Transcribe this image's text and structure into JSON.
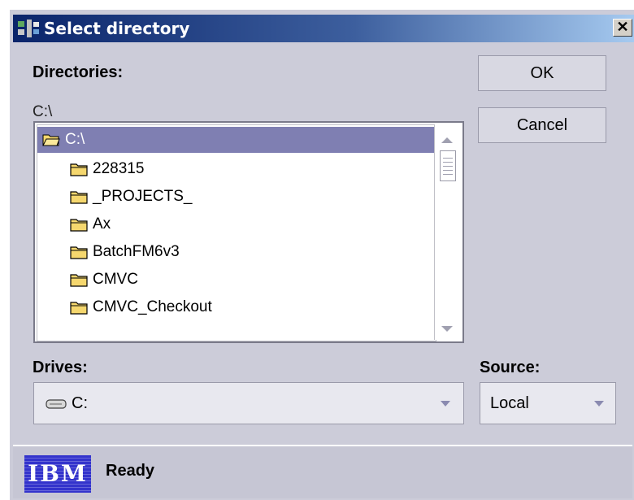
{
  "window": {
    "title": "Select directory",
    "close_symbol": "✕"
  },
  "directories": {
    "label": "Directories:",
    "current_path": "C:\\",
    "items": [
      {
        "label": "C:\\",
        "icon": "open-folder-icon",
        "selected": true
      },
      {
        "label": "228315",
        "icon": "folder-icon"
      },
      {
        "label": "_PROJECTS_",
        "icon": "folder-icon"
      },
      {
        "label": "Ax",
        "icon": "folder-icon"
      },
      {
        "label": "BatchFM6v3",
        "icon": "folder-icon"
      },
      {
        "label": "CMVC",
        "icon": "folder-icon"
      },
      {
        "label": "CMVC_Checkout",
        "icon": "folder-icon"
      }
    ]
  },
  "buttons": {
    "ok": "OK",
    "cancel": "Cancel"
  },
  "drives": {
    "label": "Drives:",
    "selected": "C:",
    "icon": "drive-icon"
  },
  "source": {
    "label": "Source:",
    "selected": "Local"
  },
  "status": {
    "logo": "IBM",
    "text": "Ready"
  },
  "colors": {
    "title_bar": "#0a246a",
    "selection": "#7f7fb2",
    "window_bg": "#ccccd9",
    "folder": "#f5d76e"
  }
}
